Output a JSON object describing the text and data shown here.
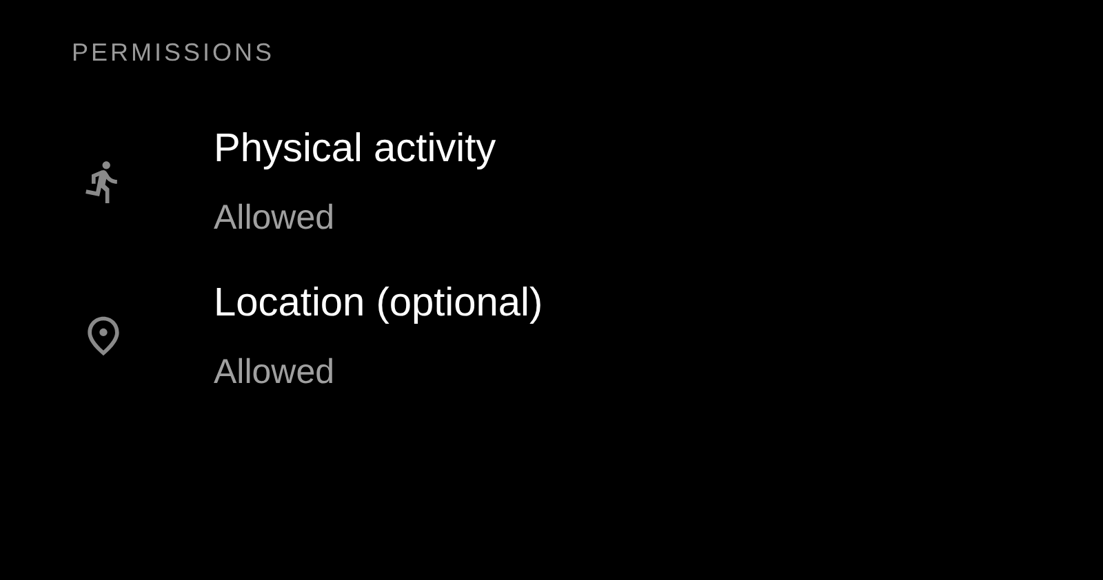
{
  "section": {
    "title": "PERMISSIONS"
  },
  "permissions": [
    {
      "kind": "activity",
      "title": "Physical activity",
      "status": "Allowed"
    },
    {
      "kind": "location",
      "title": "Location (optional)",
      "status": "Allowed"
    }
  ]
}
